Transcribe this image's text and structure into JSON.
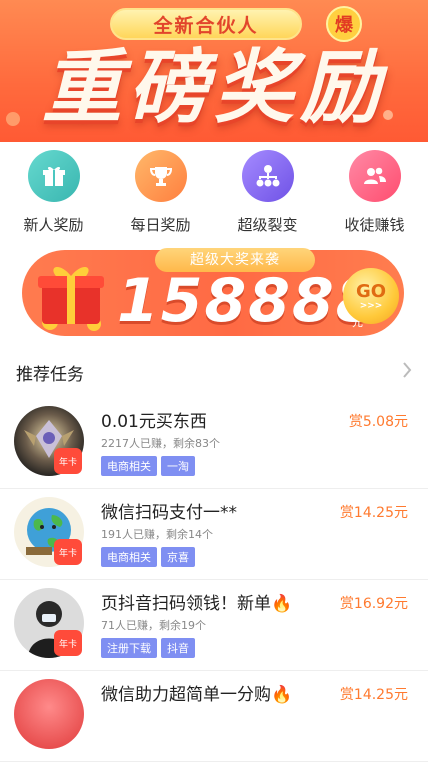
{
  "banner": {
    "pill_text": "全新合伙人",
    "burst_text": "爆",
    "title": "重磅奖励"
  },
  "shortcuts": [
    {
      "label": "新人奖励",
      "icon": "gift-icon",
      "color": "#4bc7c0"
    },
    {
      "label": "每日奖励",
      "icon": "trophy-icon",
      "color": "#ff9b4a"
    },
    {
      "label": "超级裂变",
      "icon": "network-icon",
      "color": "#8b6bf0"
    },
    {
      "label": "收徒赚钱",
      "icon": "users-icon",
      "color": "#ff5a7a"
    }
  ],
  "prize": {
    "subtitle": "超级大奖来袭",
    "amount": "158888",
    "unit": "元",
    "go_label": "GO",
    "go_arrows": ">>>"
  },
  "section": {
    "title": "推荐任务"
  },
  "tasks": [
    {
      "title": "0.01元买东西",
      "stats": "2217人已赚，剩余83个",
      "tags": [
        "电商相关",
        "一淘"
      ],
      "reward": "赏5.08元",
      "badge": "年卡"
    },
    {
      "title": "微信扫码支付一**",
      "stats": "191人已赚，剩余14个",
      "tags": [
        "电商相关",
        "京喜"
      ],
      "reward": "赏14.25元",
      "badge": "年卡"
    },
    {
      "title": "页抖音扫码领钱！新单🔥",
      "stats": "71人已赚，剩余19个",
      "tags": [
        "注册下载",
        "抖音"
      ],
      "reward": "赏16.92元",
      "badge": "年卡"
    },
    {
      "title": "微信助力超简单一分购🔥",
      "stats": "",
      "tags": [],
      "reward": "赏14.25元",
      "badge": ""
    }
  ]
}
